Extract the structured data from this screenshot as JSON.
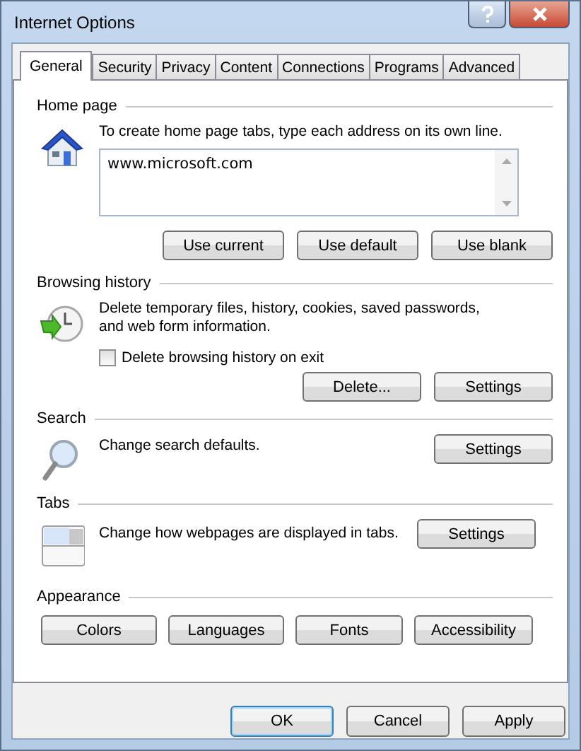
{
  "window": {
    "title": "Internet Options"
  },
  "tabs": [
    {
      "label": "General",
      "selected": true
    },
    {
      "label": "Security",
      "selected": false
    },
    {
      "label": "Privacy",
      "selected": false
    },
    {
      "label": "Content",
      "selected": false
    },
    {
      "label": "Connections",
      "selected": false
    },
    {
      "label": "Programs",
      "selected": false
    },
    {
      "label": "Advanced",
      "selected": false
    }
  ],
  "home_page": {
    "heading": "Home page",
    "description": "To create home page tabs, type each address on its own line.",
    "addresses": "www.microsoft.com",
    "buttons": [
      "Use current",
      "Use default",
      "Use blank"
    ]
  },
  "browsing_history": {
    "heading": "Browsing history",
    "description": "Delete temporary files, history, cookies, saved passwords, and web form information.",
    "delete_on_exit": {
      "label": "Delete browsing history on exit",
      "checked": false
    },
    "buttons": [
      "Delete...",
      "Settings"
    ]
  },
  "search": {
    "heading": "Search",
    "description": "Change search defaults.",
    "button": "Settings"
  },
  "tabs_section": {
    "heading": "Tabs",
    "description": "Change how webpages are displayed in tabs.",
    "button": "Settings"
  },
  "appearance": {
    "heading": "Appearance",
    "buttons": [
      "Colors",
      "Languages",
      "Fonts",
      "Accessibility"
    ]
  },
  "dialog_buttons": [
    {
      "label": "OK",
      "default": true
    },
    {
      "label": "Cancel",
      "default": false
    },
    {
      "label": "Apply",
      "default": false
    }
  ]
}
